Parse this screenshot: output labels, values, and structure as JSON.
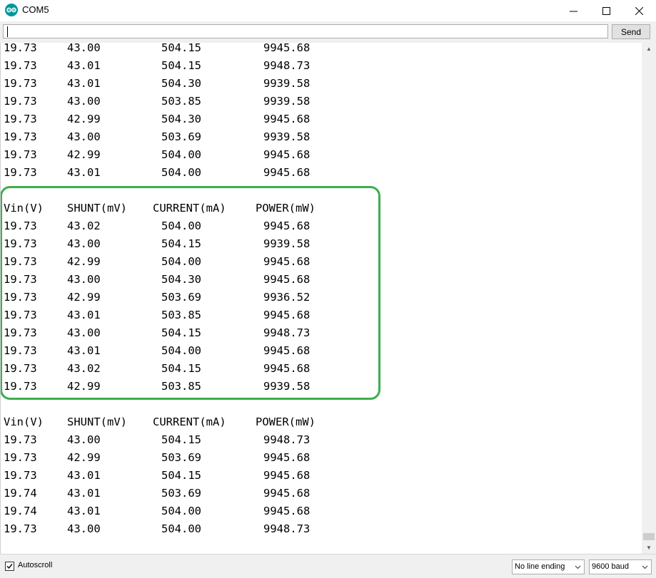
{
  "window": {
    "title": "COM5",
    "minimize_glyph": "—",
    "maximize_glyph": "☐",
    "close_glyph": "✕"
  },
  "input_bar": {
    "value": "",
    "send_label": "Send"
  },
  "serial_output": {
    "rows": [
      {
        "vin": "19.73",
        "shunt": "43.00",
        "current": "504.15",
        "power": "9945.68"
      },
      {
        "vin": "19.73",
        "shunt": "43.01",
        "current": "504.15",
        "power": "9948.73"
      },
      {
        "vin": "19.73",
        "shunt": "43.01",
        "current": "504.30",
        "power": "9939.58"
      },
      {
        "vin": "19.73",
        "shunt": "43.00",
        "current": "503.85",
        "power": "9939.58"
      },
      {
        "vin": "19.73",
        "shunt": "42.99",
        "current": "504.30",
        "power": "9945.68"
      },
      {
        "vin": "19.73",
        "shunt": "43.00",
        "current": "503.69",
        "power": "9939.58"
      },
      {
        "vin": "19.73",
        "shunt": "42.99",
        "current": "504.00",
        "power": "9945.68"
      },
      {
        "vin": "19.73",
        "shunt": "43.01",
        "current": "504.00",
        "power": "9945.68"
      },
      {
        "blank": true
      },
      {
        "vin": "Vin(V)",
        "shunt": "SHUNT(mV)",
        "current": "CURRENT(mA)",
        "power": "POWER(mW)",
        "header": true
      },
      {
        "vin": "19.73",
        "shunt": "43.02",
        "current": "504.00",
        "power": "9945.68"
      },
      {
        "vin": "19.73",
        "shunt": "43.00",
        "current": "504.15",
        "power": "9939.58"
      },
      {
        "vin": "19.73",
        "shunt": "42.99",
        "current": "504.00",
        "power": "9945.68"
      },
      {
        "vin": "19.73",
        "shunt": "43.00",
        "current": "504.30",
        "power": "9945.68"
      },
      {
        "vin": "19.73",
        "shunt": "42.99",
        "current": "503.69",
        "power": "9936.52"
      },
      {
        "vin": "19.73",
        "shunt": "43.01",
        "current": "503.85",
        "power": "9945.68"
      },
      {
        "vin": "19.73",
        "shunt": "43.00",
        "current": "504.15",
        "power": "9948.73"
      },
      {
        "vin": "19.73",
        "shunt": "43.01",
        "current": "504.00",
        "power": "9945.68"
      },
      {
        "vin": "19.73",
        "shunt": "43.02",
        "current": "504.15",
        "power": "9945.68"
      },
      {
        "vin": "19.73",
        "shunt": "42.99",
        "current": "503.85",
        "power": "9939.58"
      },
      {
        "blank": true
      },
      {
        "vin": "Vin(V)",
        "shunt": "SHUNT(mV)",
        "current": "CURRENT(mA)",
        "power": "POWER(mW)",
        "header": true
      },
      {
        "vin": "19.73",
        "shunt": "43.00",
        "current": "504.15",
        "power": "9948.73"
      },
      {
        "vin": "19.73",
        "shunt": "42.99",
        "current": "503.69",
        "power": "9945.68"
      },
      {
        "vin": "19.73",
        "shunt": "43.01",
        "current": "504.15",
        "power": "9945.68"
      },
      {
        "vin": "19.74",
        "shunt": "43.01",
        "current": "503.69",
        "power": "9945.68"
      },
      {
        "vin": "19.74",
        "shunt": "43.01",
        "current": "504.00",
        "power": "9945.68"
      },
      {
        "vin": "19.73",
        "shunt": "43.00",
        "current": "504.00",
        "power": "9948.73"
      }
    ],
    "highlight_color": "#3cae4e"
  },
  "status_bar": {
    "autoscroll_label": "Autoscroll",
    "autoscroll_checked": true,
    "line_ending": "No line ending",
    "baud_rate": "9600 baud"
  },
  "colors": {
    "app_icon": "#00979c",
    "highlight_box": "#3cae4e"
  }
}
